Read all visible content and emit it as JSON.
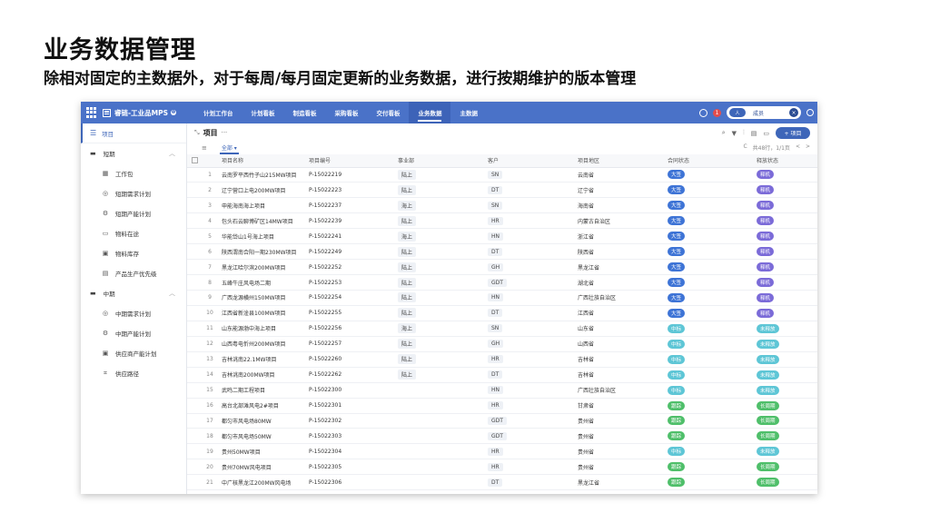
{
  "slide": {
    "title": "业务数据管理",
    "subtitle": "除相对固定的主数据外，对于每周/每月固定更新的业务数据，进行按期维护的版本管理"
  },
  "app": {
    "name": "睿链-工业品MPS",
    "info_icon": "❶",
    "nav": [
      "计划工作台",
      "计划看板",
      "制造看板",
      "采购看板",
      "交付看板",
      "业务数据",
      "主数据"
    ],
    "active_nav": "业务数据",
    "alert_count": "1",
    "user_avatar_text": "人",
    "user_name": "成员",
    "user_close": "×"
  },
  "sidebar": {
    "top_label": "项目",
    "groups": [
      {
        "label": "短期",
        "items": [
          "工作包",
          "短期需求计划",
          "短期产能计划",
          "物料在途",
          "物料库存",
          "产品生产优先级"
        ]
      },
      {
        "label": "中期",
        "items": [
          "中期需求计划",
          "中期产能计划",
          "供应商产能计划",
          "供应路径"
        ]
      }
    ]
  },
  "main": {
    "title": "项目",
    "more": "···",
    "add_button": "+ 项目",
    "tab_all": "全部 ▾",
    "pager_text": "共48行，1/1页",
    "refresh_icon": "C",
    "prev": "<",
    "next": ">",
    "columns": [
      "项目名称",
      "项目编号",
      "事业部",
      "客户",
      "项目地区",
      "合同状态",
      "释放状态"
    ]
  },
  "colors": {
    "primary": "#4a72c8",
    "blue_pill": "#3e74d6",
    "purple_pill": "#7b6bd8",
    "cyan_pill": "#5ec6d6",
    "green_pill": "#4fbf6a"
  },
  "rows": [
    {
      "no": "1",
      "name": "云南罗平西竹子山215MW项目",
      "code": "P-15022219",
      "div": "陆上",
      "client": "SN",
      "region": "云南省",
      "contract": "大签",
      "release": "释机"
    },
    {
      "no": "2",
      "name": "辽宁营口上电200MW项目",
      "code": "P-15022223",
      "div": "陆上",
      "client": "DT",
      "region": "辽宁省",
      "contract": "大签",
      "release": "释机"
    },
    {
      "no": "3",
      "name": "申能海南海上项目",
      "code": "P-15022237",
      "div": "海上",
      "client": "SN",
      "region": "海南省",
      "contract": "大签",
      "release": "释机"
    },
    {
      "no": "4",
      "name": "包头石云聊博矿区14MW项目",
      "code": "P-15022239",
      "div": "陆上",
      "client": "HR",
      "region": "内蒙古自治区",
      "contract": "大签",
      "release": "释机"
    },
    {
      "no": "5",
      "name": "华能岱山1号海上项目",
      "code": "P-15022241",
      "div": "海上",
      "client": "HN",
      "region": "浙江省",
      "contract": "大签",
      "release": "释机"
    },
    {
      "no": "6",
      "name": "陕西渭南合阳一期230MW项目",
      "code": "P-15022249",
      "div": "陆上",
      "client": "DT",
      "region": "陕西省",
      "contract": "大签",
      "release": "释机"
    },
    {
      "no": "7",
      "name": "黑龙江哈尔滨200MW项目",
      "code": "P-15022252",
      "div": "陆上",
      "client": "GH",
      "region": "黑龙江省",
      "contract": "大签",
      "release": "释机"
    },
    {
      "no": "8",
      "name": "五峰牛庄风电场二期",
      "code": "P-15022253",
      "div": "陆上",
      "client": "GDT",
      "region": "湖北省",
      "contract": "大签",
      "release": "释机"
    },
    {
      "no": "9",
      "name": "广西龙源横州150MW项目",
      "code": "P-15022254",
      "div": "陆上",
      "client": "HN",
      "region": "广西壮族自治区",
      "contract": "大签",
      "release": "释机"
    },
    {
      "no": "10",
      "name": "江西省新淦县100MW项目",
      "code": "P-15022255",
      "div": "陆上",
      "client": "DT",
      "region": "江西省",
      "contract": "大签",
      "release": "释机"
    },
    {
      "no": "11",
      "name": "山东能源渤中海上项目",
      "code": "P-15022256",
      "div": "海上",
      "client": "SN",
      "region": "山东省",
      "contract": "中标",
      "release": "未释放"
    },
    {
      "no": "12",
      "name": "山西粤电忻州200MW项目",
      "code": "P-15022257",
      "div": "陆上",
      "client": "GH",
      "region": "山西省",
      "contract": "中标",
      "release": "未释放"
    },
    {
      "no": "13",
      "name": "吉林洮南22.1MW项目",
      "code": "P-15022260",
      "div": "陆上",
      "client": "HR",
      "region": "吉林省",
      "contract": "中标",
      "release": "未释放"
    },
    {
      "no": "14",
      "name": "吉林洮南200MW项目",
      "code": "P-15022262",
      "div": "陆上",
      "client": "DT",
      "region": "吉林省",
      "contract": "中标",
      "release": "未释放"
    },
    {
      "no": "15",
      "name": "武鸣二期工程项目",
      "code": "P-15022300",
      "div": "",
      "client": "HN",
      "region": "广西壮族自治区",
      "contract": "中标",
      "release": "未释放"
    },
    {
      "no": "16",
      "name": "高台北部滩风电2#项目",
      "code": "P-15022301",
      "div": "",
      "client": "HR",
      "region": "甘肃省",
      "contract": "跟踪",
      "release": "长周期"
    },
    {
      "no": "17",
      "name": "都匀市风电场80MW",
      "code": "P-15022302",
      "div": "",
      "client": "GDT",
      "region": "贵州省",
      "contract": "跟踪",
      "release": "长周期"
    },
    {
      "no": "18",
      "name": "都匀市风电场50MW",
      "code": "P-15022303",
      "div": "",
      "client": "GDT",
      "region": "贵州省",
      "contract": "跟踪",
      "release": "长周期"
    },
    {
      "no": "19",
      "name": "贵州50MW项目",
      "code": "P-15022304",
      "div": "",
      "client": "HR",
      "region": "贵州省",
      "contract": "中标",
      "release": "未释放"
    },
    {
      "no": "20",
      "name": "贵州70MW风电项目",
      "code": "P-15022305",
      "div": "",
      "client": "HR",
      "region": "贵州省",
      "contract": "跟踪",
      "release": "长周期"
    },
    {
      "no": "21",
      "name": "中广核黑龙江200MW风电场",
      "code": "P-15022306",
      "div": "",
      "client": "DT",
      "region": "黑龙江省",
      "contract": "跟踪",
      "release": "长周期"
    }
  ]
}
